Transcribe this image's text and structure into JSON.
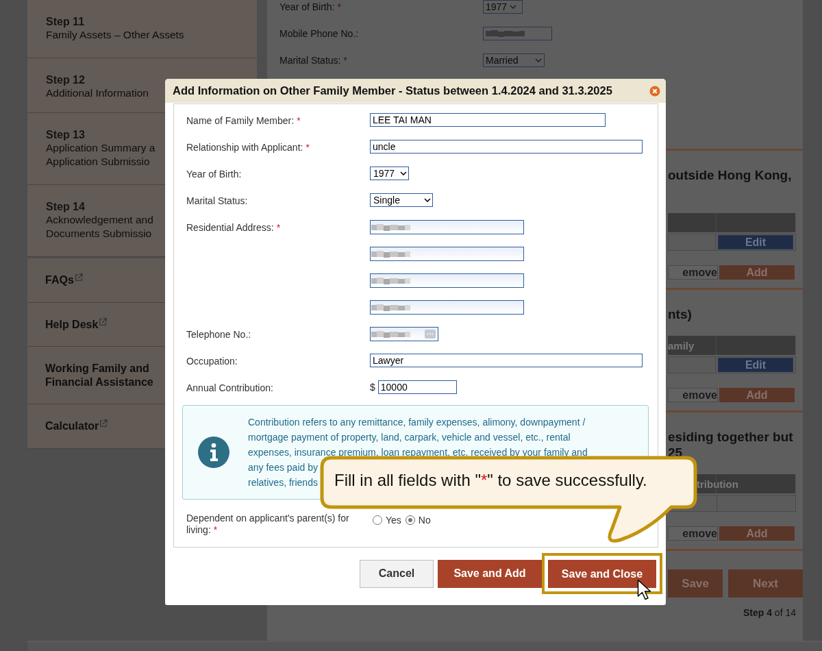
{
  "background_page": {
    "sidebar": {
      "steps": [
        {
          "number": "Step 11",
          "lines": [
            "Family Assets – Other Assets"
          ]
        },
        {
          "number": "Step 12",
          "lines": [
            "Additional Information"
          ]
        },
        {
          "number": "Step 13",
          "lines": [
            "Application Summary a",
            "Application Submissio"
          ]
        },
        {
          "number": "Step 14",
          "lines": [
            "Acknowledgement and",
            "Documents Submissio"
          ]
        }
      ],
      "links": [
        {
          "lines": [
            "FAQs"
          ],
          "external": true
        },
        {
          "lines": [
            "Help Desk"
          ],
          "external": true
        },
        {
          "lines": [
            "Working Family and",
            "Financial Assistance"
          ],
          "external": false
        },
        {
          "lines": [
            "Calculator"
          ],
          "external": true
        }
      ]
    },
    "fields": [
      {
        "label": "Year of Birth:",
        "required_mark": "*",
        "kind": "select",
        "value": "1977"
      },
      {
        "label": "Mobile Phone No.:",
        "kind": "blurred"
      },
      {
        "label": "Marital Status:",
        "required_mark": "*",
        "kind": "select",
        "value": "Married"
      }
    ],
    "sections": [
      {
        "heading_lines": [
          "outside Hong Kong,"
        ],
        "row_button": "Edit",
        "actions": [
          "emove",
          "Add"
        ]
      },
      {
        "heading_lines": [
          "nts)"
        ],
        "column_1": "amily",
        "row_button": "Edit",
        "actions": [
          "emove",
          "Add"
        ]
      },
      {
        "heading_lines": [
          "esiding together but",
          "25"
        ],
        "column_1": "tribution",
        "actions": [
          "emove",
          "Add"
        ]
      }
    ],
    "nav_buttons": [
      "Save",
      "Next"
    ],
    "step_counter": "**Step 4** of 14"
  },
  "dialog": {
    "title": "Add Information on Other Family Member - Status between 1.4.2024 and 31.3.2025",
    "fields": [
      {
        "label": "Name of Family Member:",
        "required_mark": "*",
        "kind": "text",
        "value": "LEE TAI MAN"
      },
      {
        "label": "Relationship with Applicant:",
        "required_mark": "*",
        "kind": "long_text",
        "value": "uncle"
      },
      {
        "label": "Year of Birth:",
        "kind": "select",
        "value": "1977"
      },
      {
        "label": "Marital Status:",
        "kind": "select",
        "value": "Single"
      },
      {
        "label": "Residential Address:",
        "required_mark": "*",
        "kind": "blurred"
      },
      {
        "kind": "blurred"
      },
      {
        "kind": "blurred"
      },
      {
        "kind": "blurred"
      },
      {
        "label": "Telephone No.:",
        "kind": "blurred_picker"
      },
      {
        "label": "Occupation:",
        "kind": "long_text",
        "value": "Lawyer"
      },
      {
        "label": "Annual Contribution:",
        "kind": "money",
        "currency": "$",
        "value": "10000"
      }
    ],
    "info_lines": [
      "Contribution refers to any remittance, family expenses, alimony, downpayment /",
      "mortgage payment of property, land, carpark, vehicle and vessel, etc., rental",
      "expenses, insurance premium, loan repayment, etc. received by your family and",
      "any fees paid by",
      "relatives, friends"
    ],
    "dependent": {
      "label": "Dependent on applicant's parent(s) for living:",
      "required_mark": "*",
      "options": [
        {
          "label": "Yes",
          "selected": false
        },
        {
          "label": "No",
          "selected": true
        }
      ]
    },
    "buttons": [
      {
        "label": "Cancel",
        "kind": "secondary",
        "highlighted": false
      },
      {
        "label": "Save and Add",
        "kind": "primary",
        "highlighted": false
      },
      {
        "label": "Save and Close",
        "kind": "primary",
        "highlighted": true
      }
    ]
  },
  "callout": {
    "before": "Fill in all fields with \"",
    "mark": "*",
    "after": "\" to save successfully."
  }
}
